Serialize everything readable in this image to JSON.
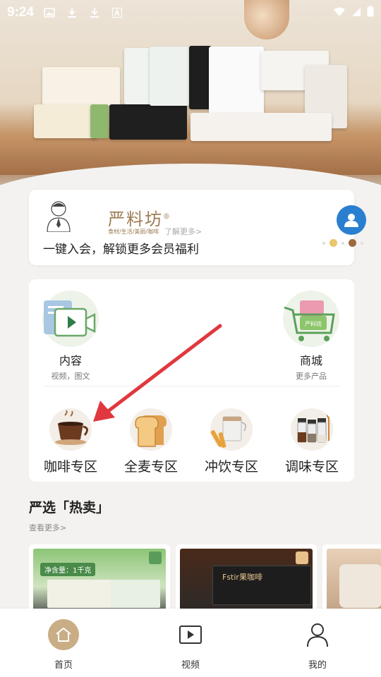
{
  "status_bar": {
    "time": "9:24"
  },
  "member": {
    "brand_name": "严料坊",
    "brand_mark": "®",
    "brand_sub": "食材/生活/美丽/咖啡",
    "learn_more": "了解更多>",
    "prompt": "一键入会，解锁更多会员福利"
  },
  "services": [
    {
      "title": "内容",
      "subtitle": "视频，图文"
    },
    {
      "title": "商城",
      "subtitle": "更多产品"
    }
  ],
  "categories": [
    {
      "label": "咖啡专区"
    },
    {
      "label": "全麦专区"
    },
    {
      "label": "冲饮专区"
    },
    {
      "label": "调味专区"
    }
  ],
  "hot": {
    "title": "严选「热卖」",
    "more": "查看更多>"
  },
  "products": [
    {
      "badge": "净含量：1千克"
    },
    {
      "badge": "Fstir果咖啡"
    },
    {
      "badge": ""
    }
  ],
  "bottom_nav": [
    {
      "label": "首页"
    },
    {
      "label": "视频"
    },
    {
      "label": "我的"
    }
  ],
  "colors": {
    "accent": "#c9ad85",
    "arrow": "#e0383e",
    "avatar": "#2a7fd0"
  }
}
